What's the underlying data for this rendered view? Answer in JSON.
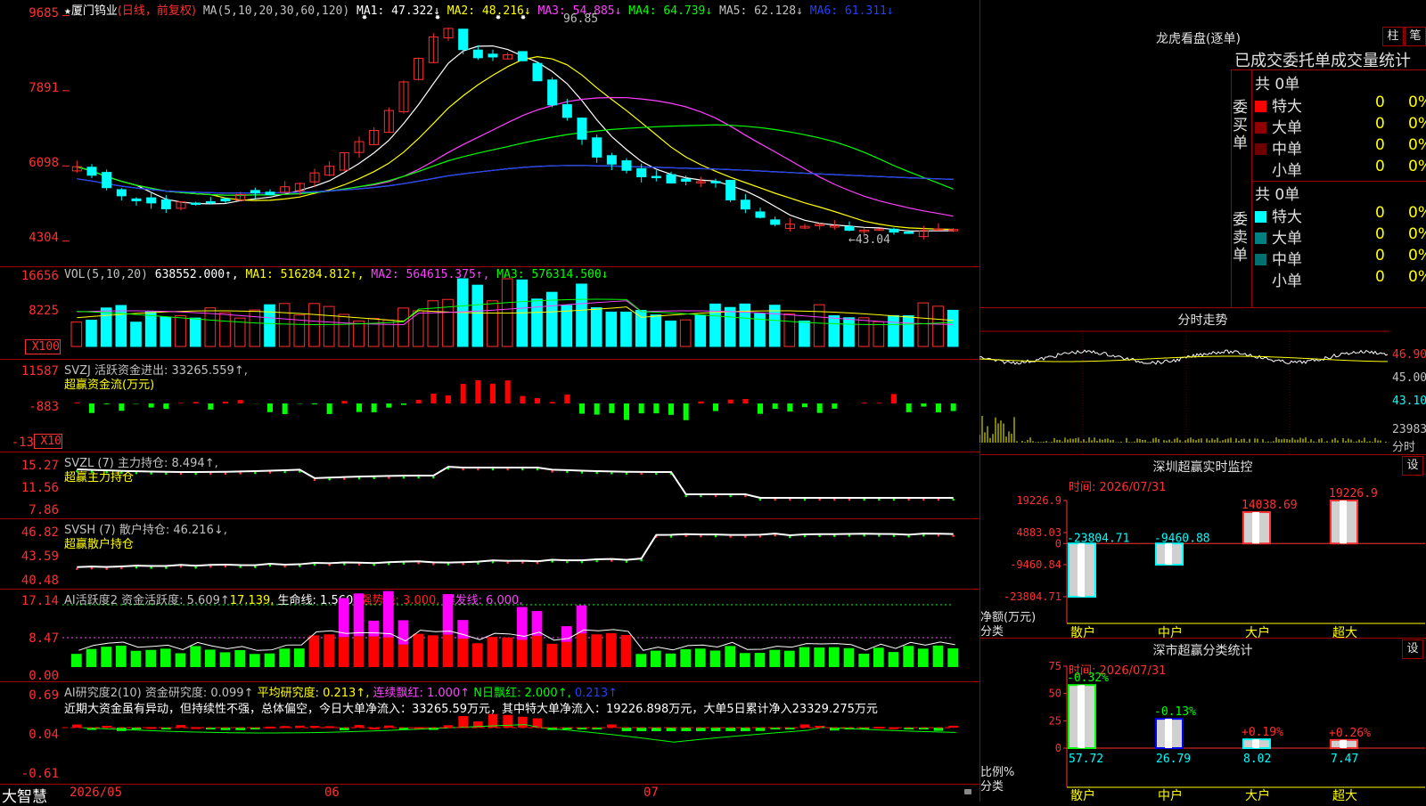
{
  "stock": {
    "name": "厦门钨业",
    "star": "★",
    "mode": "(日线，前复权)"
  },
  "panels": {
    "price": {
      "ma_header": "MA(5,10,20,30,60,120)",
      "ma": [
        {
          "label": "MA1: 47.322↓",
          "color": "#ffffff"
        },
        {
          "label": "MA2: 48.216↓",
          "color": "#ffff00"
        },
        {
          "label": "MA3: 54.885↓",
          "color": "#ff40ff"
        },
        {
          "label": "MA4: 64.739↓",
          "color": "#00ff00"
        },
        {
          "label": "MA5: 62.128↓",
          "color": "#c0c0c0"
        },
        {
          "label": "MA6: 61.311↓",
          "color": "#2040ff"
        }
      ],
      "axis": [
        "9685",
        "7891",
        "6098",
        "4304"
      ],
      "high_note": "96.85",
      "low_note": "←43.04"
    },
    "vol": {
      "header": "VOL(5,10,20)",
      "value": "638552.000↑,",
      "ma": [
        {
          "label": "MA1: 516284.812↑,",
          "color": "#ffff00"
        },
        {
          "label": "MA2: 564615.375↑,",
          "color": "#ff40ff"
        },
        {
          "label": "MA3: 576314.500↓",
          "color": "#00ff00"
        }
      ],
      "axis": [
        "16656",
        "8225"
      ],
      "unit": "X100"
    },
    "svzj": {
      "header": "SVZJ  活跃资金进出: 33265.559↑,",
      "sub": "超赢资金流(万元)",
      "axis": [
        "11587",
        "-883",
        "-13"
      ],
      "unit": "X10"
    },
    "svzl": {
      "header": "SVZL (7) 主力持仓: 8.494↑,",
      "sub": "超赢主力持仓",
      "axis": [
        "15.27",
        "11.56",
        "7.86"
      ]
    },
    "svsh": {
      "header": "SVSH (7) 散户持仓: 46.216↓,",
      "sub": "超赢散户持仓",
      "axis": [
        "46.82",
        "43.59",
        "40.48"
      ]
    },
    "ai1": {
      "header": "AI活跃度2 资金活跃度: 5.609↑",
      "v2": "17.139,",
      "life": "生命线: 1.560,",
      "strong": "强势线: 3.000,",
      "burst": "爆发线: 6.000,",
      "axis": [
        "17.14",
        "8.47",
        "0.00"
      ]
    },
    "ai2": {
      "header": "AI研究度2(10) 资金研究度: 0.099↑",
      "avg": "平均研究度: 0.213↑,",
      "cont": "连续飘红: 1.000↑",
      "nday": "N日飘红: 2.000↑,",
      "v": "0.213↑",
      "comment": "近期大资金虽有异动，但持续性不强，总体偏空，今日大单净流入：33265.59万元，其中特大单净流入：19226.898万元，大单5日累计净入23329.275万元",
      "axis": [
        "0.69",
        "0.04",
        "-0.61"
      ]
    }
  },
  "footer": {
    "brand": "大智慧",
    "dates": [
      "2026/05",
      "06",
      "07"
    ]
  },
  "right": {
    "dragon_title": "龙虎看盘(逐单)",
    "btn1": "柱",
    "btn2": "笔",
    "stat_title": "已成交委托单成交量统计",
    "buy_label": "委买单",
    "sell_label": "委卖单",
    "buy_total": "共 0单",
    "sell_total": "共 0单",
    "buy_rows": [
      {
        "name": "特大",
        "n": "0",
        "p": "0%",
        "color": "#ff0000"
      },
      {
        "name": "大单",
        "n": "0",
        "p": "0%",
        "color": "#900000"
      },
      {
        "name": "中单",
        "n": "0",
        "p": "0%",
        "color": "#700000"
      },
      {
        "name": "小单",
        "n": "0",
        "p": "0%",
        "color": "#000000"
      }
    ],
    "sell_rows": [
      {
        "name": "特大",
        "n": "0",
        "p": "0%",
        "color": "#00ffff"
      },
      {
        "name": "大单",
        "n": "0",
        "p": "0%",
        "color": "#008080"
      },
      {
        "name": "中单",
        "n": "0",
        "p": "0%",
        "color": "#007070"
      },
      {
        "name": "小单",
        "n": "0",
        "p": "0%",
        "color": "#000000"
      }
    ],
    "intraday_title": "分时走势",
    "intraday_axis": [
      "46.90",
      "45.00",
      "43.10",
      "23983",
      "分时"
    ],
    "sz_title": "深圳超赢实时监控",
    "sz_btn": "设",
    "sz_time": "时间: 2026/07/31",
    "sz_axis": [
      "19226.9",
      "4883.03",
      "0",
      "-9460.84",
      "-23804.71"
    ],
    "sz_ylabel": "净额(万元)",
    "sz_xlabel": "分类",
    "sz_bars": [
      {
        "cat": "散户",
        "value": -23804.71,
        "label": "-23804.71"
      },
      {
        "cat": "中户",
        "value": -9460.88,
        "label": "-9460.88"
      },
      {
        "cat": "大户",
        "value": 14038.69,
        "label": "14038.69"
      },
      {
        "cat": "超大",
        "value": 19226.9,
        "label": "19226.9"
      }
    ],
    "cls_title": "深市超赢分类统计",
    "cls_btn": "设",
    "cls_time": "时间: 2026/07/31",
    "cls_axis": [
      "75",
      "50",
      "25",
      "0"
    ],
    "cls_ylabel": "比例%",
    "cls_xlabel": "分类",
    "cls_bars": [
      {
        "cat": "散户",
        "value": 57.72,
        "label": "57.72",
        "chg": "-0.32%"
      },
      {
        "cat": "中户",
        "value": 26.79,
        "label": "26.79",
        "chg": "-0.13%"
      },
      {
        "cat": "大户",
        "value": 8.02,
        "label": "8.02",
        "chg": "+0.19%"
      },
      {
        "cat": "超大",
        "value": 7.47,
        "label": "7.47",
        "chg": "+0.26%"
      }
    ]
  },
  "chart_data": [
    {
      "type": "candlestick",
      "categories": [
        "2026/05",
        "06",
        "07"
      ],
      "ylim": [
        4304,
        9685
      ],
      "high": "96.85",
      "low": "43.04",
      "series": [
        {
          "name": "MA1",
          "values": [
            47.322
          ]
        },
        {
          "name": "MA2",
          "values": [
            48.216
          ]
        },
        {
          "name": "MA3",
          "values": [
            54.885
          ]
        },
        {
          "name": "MA4",
          "values": [
            64.739
          ]
        },
        {
          "name": "MA5",
          "values": [
            62.128
          ]
        },
        {
          "name": "MA6",
          "values": [
            61.311
          ]
        }
      ]
    },
    {
      "type": "bar",
      "title": "VOL(5,10,20)",
      "series": [
        {
          "name": "VOL",
          "values": [
            638552.0
          ]
        },
        {
          "name": "MA1",
          "values": [
            516284.812
          ]
        },
        {
          "name": "MA2",
          "values": [
            564615.375
          ]
        },
        {
          "name": "MA3",
          "values": [
            576314.5
          ]
        }
      ]
    },
    {
      "type": "bar",
      "title": "深圳超赢实时监控",
      "categories": [
        "散户",
        "中户",
        "大户",
        "超大"
      ],
      "values": [
        -23804.71,
        -9460.88,
        14038.69,
        19226.9
      ],
      "ylabel": "净额(万元)",
      "xlabel": "分类",
      "ylim": [
        -23804.71,
        19226.9
      ]
    },
    {
      "type": "bar",
      "title": "深市超赢分类统计",
      "categories": [
        "散户",
        "中户",
        "大户",
        "超大"
      ],
      "values": [
        57.72,
        26.79,
        8.02,
        7.47
      ],
      "ylabel": "比例%",
      "xlabel": "分类",
      "ylim": [
        0,
        75
      ]
    }
  ]
}
